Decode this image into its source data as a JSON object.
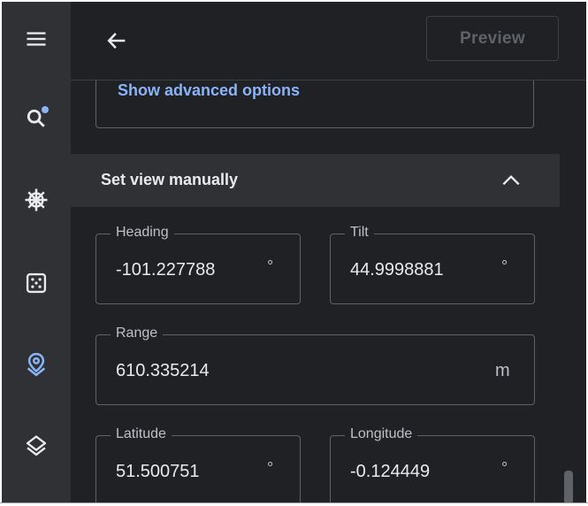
{
  "rail": {
    "items": [
      {
        "icon": "menu-icon"
      },
      {
        "icon": "search-icon",
        "badge": true
      },
      {
        "icon": "ship-wheel-icon"
      },
      {
        "icon": "dice-icon"
      },
      {
        "icon": "location-pin-icon",
        "active": true
      },
      {
        "icon": "layers-icon"
      }
    ],
    "accent": "#8ab4f8"
  },
  "topbar": {
    "back_icon": "arrow-left-icon",
    "preview_label": "Preview"
  },
  "advanced": {
    "link_label": "Show advanced options"
  },
  "section": {
    "title": "Set view manually",
    "chevron_icon": "chevron-up-icon"
  },
  "fields": {
    "heading": {
      "label": "Heading",
      "value": "-101.227788",
      "unit": "°"
    },
    "tilt": {
      "label": "Tilt",
      "value": "44.9998881",
      "unit": "°"
    },
    "range": {
      "label": "Range",
      "value": "610.335214",
      "unit": "m"
    },
    "latitude": {
      "label": "Latitude",
      "value": "51.500751",
      "unit": "°"
    },
    "longitude": {
      "label": "Longitude",
      "value": "-0.124449",
      "unit": "°"
    }
  }
}
